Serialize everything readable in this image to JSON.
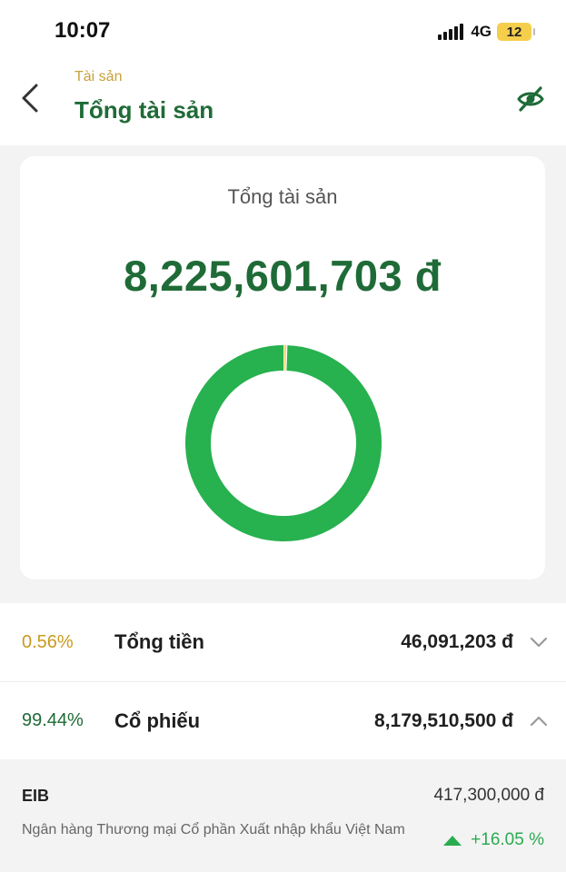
{
  "status_bar": {
    "time": "10:07",
    "network": "4G",
    "battery": "12"
  },
  "header": {
    "breadcrumb": "Tài sản",
    "title": "Tổng tài sản",
    "back_icon": "chevron-left-icon",
    "visibility_icon": "eye-off-icon"
  },
  "summary": {
    "label": "Tổng tài sản",
    "total": "8,225,601,703 đ"
  },
  "categories": [
    {
      "percent_label": "0.56%",
      "share": 0.56,
      "name": "Tổng tiền",
      "amount": "46,091,203 đ",
      "color": "#f0d56a",
      "expanded": false
    },
    {
      "percent_label": "99.44%",
      "share": 99.44,
      "name": "Cổ phiếu",
      "amount": "8,179,510,500 đ",
      "color": "#27b14f",
      "expanded": true
    }
  ],
  "holdings": [
    {
      "ticker": "EIB",
      "value": "417,300,000 đ",
      "company": "Ngân hàng Thương mại Cổ phần Xuất nhập khẩu Việt Nam",
      "change": "+16.05 %",
      "direction_icon": "triangle-up-icon"
    }
  ],
  "colors": {
    "brand_green": "#1f6b37",
    "accent_gold": "#c7a13a",
    "positive": "#2bab4f"
  }
}
